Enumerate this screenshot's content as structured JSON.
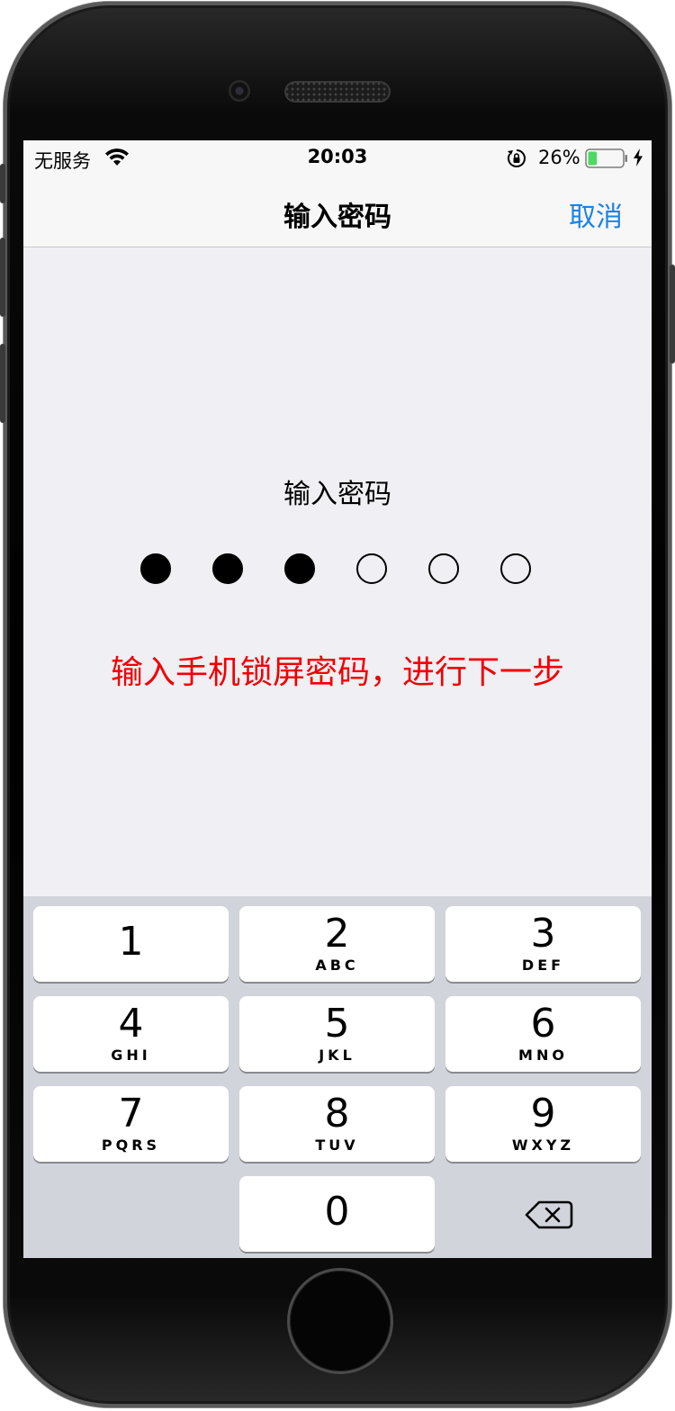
{
  "status_bar": {
    "carrier": "无服务",
    "time": "20:03",
    "battery": "26%",
    "battery_level": 0.26,
    "battery_color": "#4cd964"
  },
  "nav": {
    "title": "输入密码",
    "cancel": "取消",
    "accent_color": "#1a82e8"
  },
  "passcode": {
    "prompt": "输入密码",
    "length": 6,
    "entered": 3
  },
  "hint": {
    "text": "输入手机锁屏密码，进行下一步",
    "color": "#f00000"
  },
  "keypad": {
    "keys": [
      {
        "digit": "1",
        "letters": ""
      },
      {
        "digit": "2",
        "letters": "ABC"
      },
      {
        "digit": "3",
        "letters": "DEF"
      },
      {
        "digit": "4",
        "letters": "GHI"
      },
      {
        "digit": "5",
        "letters": "JKL"
      },
      {
        "digit": "6",
        "letters": "MNO"
      },
      {
        "digit": "7",
        "letters": "PQRS"
      },
      {
        "digit": "8",
        "letters": "TUV"
      },
      {
        "digit": "9",
        "letters": "WXYZ"
      },
      {
        "digit": "0",
        "letters": ""
      }
    ],
    "delete_icon": "delete-icon"
  }
}
